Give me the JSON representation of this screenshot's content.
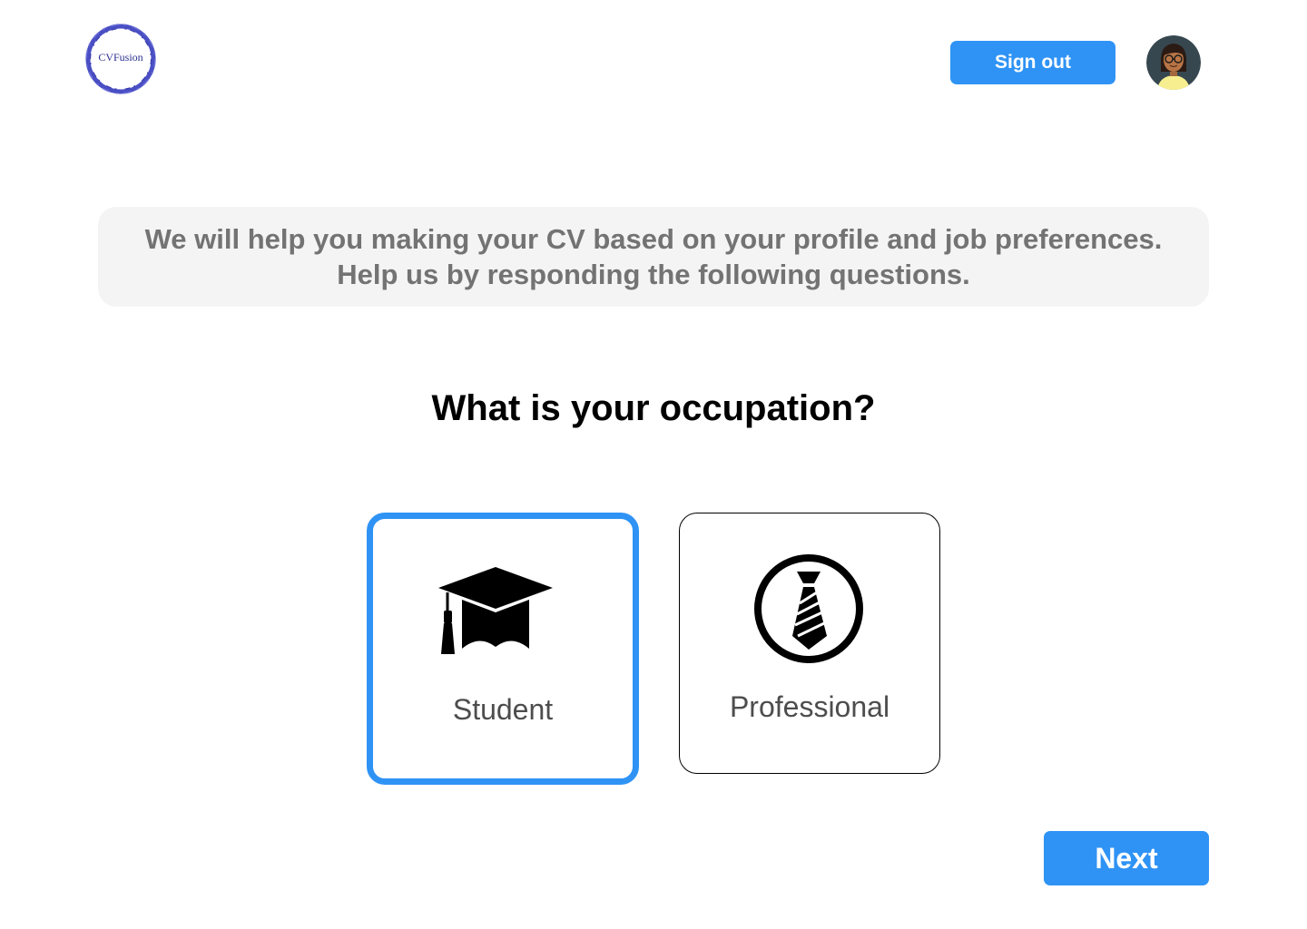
{
  "header": {
    "logo_text": "CVFusion",
    "signout_label": "Sign out"
  },
  "intro": {
    "line1": "We will help you making your CV based on your  profile and job preferences.",
    "line2": "Help us by responding the following questions."
  },
  "question": "What is your occupation?",
  "options": [
    {
      "label": "Student",
      "icon": "graduation-cap-icon",
      "selected": true
    },
    {
      "label": "Professional",
      "icon": "tie-icon",
      "selected": false
    }
  ],
  "footer": {
    "next_label": "Next"
  },
  "colors": {
    "accent": "#2f93f5",
    "intro_bg": "#f4f4f4",
    "intro_text": "#737373",
    "logo": "#4a4fc4"
  }
}
